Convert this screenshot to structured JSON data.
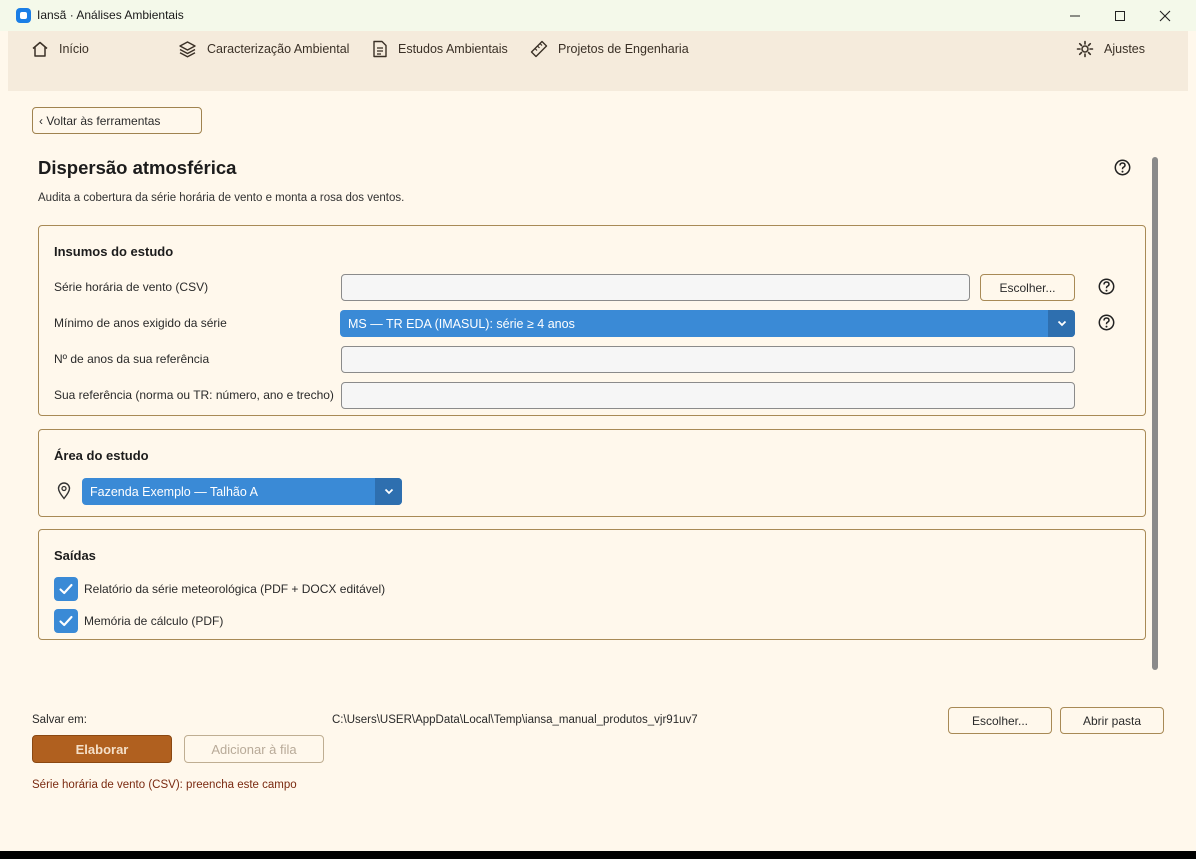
{
  "window": {
    "title": "Iansã · Análises Ambientais"
  },
  "nav": {
    "items": [
      {
        "label": "Início",
        "icon": "home-icon"
      },
      {
        "label": "Caracterização Ambiental",
        "icon": "layers-icon"
      },
      {
        "label": "Estudos Ambientais",
        "icon": "document-icon"
      },
      {
        "label": "Projetos de Engenharia",
        "icon": "ruler-icon"
      }
    ],
    "settings_label": "Ajustes"
  },
  "page": {
    "back_label": "‹ Voltar às ferramentas",
    "title": "Dispersão atmosférica",
    "description": "Audita a cobertura da série horária de vento e monta a rosa dos ventos."
  },
  "inputs": {
    "title": "Insumos do estudo",
    "wind_series_label": "Série horária de vento (CSV)",
    "wind_series_value": "",
    "choose_label": "Escolher...",
    "min_years_label": "Mínimo de anos exigido da série",
    "min_years_selected": "MS — TR EDA (IMASUL): série ≥ 4 anos",
    "ref_years_label": "Nº de anos da sua referência",
    "ref_years_value": "",
    "ref_label": "Sua referência (norma ou TR: número, ano e trecho)",
    "ref_value": ""
  },
  "area": {
    "title": "Área do estudo",
    "selected": "Fazenda Exemplo — Talhão A"
  },
  "outputs": {
    "title": "Saídas",
    "items": [
      {
        "label": "Relatório da série meteorológica (PDF + DOCX editável)",
        "checked": true
      },
      {
        "label": "Memória de cálculo (PDF)",
        "checked": true
      }
    ]
  },
  "footer": {
    "save_label": "Salvar em:",
    "save_path": "C:\\Users\\USER\\AppData\\Local\\Temp\\iansa_manual_produtos_vjr91uv7",
    "choose_label": "Escolher...",
    "open_folder_label": "Abrir pasta",
    "elaborate_label": "Elaborar",
    "queue_label": "Adicionar à fila",
    "error_message": "Série horária de vento (CSV): preencha este campo"
  },
  "colors": {
    "accent_blue": "#3a8ad6",
    "primary_brown": "#b0601f",
    "background": "#fff8ec",
    "nav_background": "#f5ebdc",
    "error": "#7a2a10"
  }
}
